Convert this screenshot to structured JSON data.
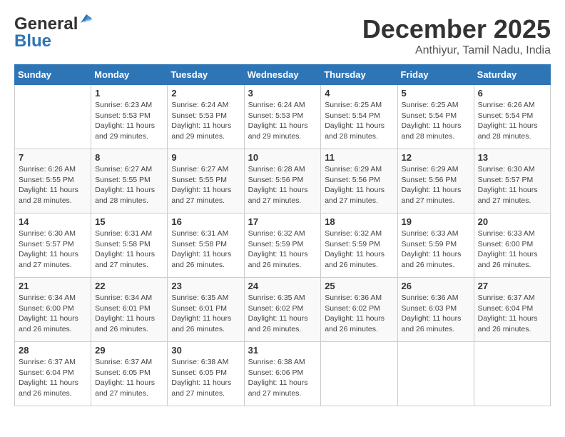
{
  "header": {
    "logo_general": "General",
    "logo_blue": "Blue",
    "month_title": "December 2025",
    "subtitle": "Anthiyur, Tamil Nadu, India"
  },
  "days_of_week": [
    "Sunday",
    "Monday",
    "Tuesday",
    "Wednesday",
    "Thursday",
    "Friday",
    "Saturday"
  ],
  "weeks": [
    [
      {
        "day": "",
        "info": ""
      },
      {
        "day": "1",
        "info": "Sunrise: 6:23 AM\nSunset: 5:53 PM\nDaylight: 11 hours\nand 29 minutes."
      },
      {
        "day": "2",
        "info": "Sunrise: 6:24 AM\nSunset: 5:53 PM\nDaylight: 11 hours\nand 29 minutes."
      },
      {
        "day": "3",
        "info": "Sunrise: 6:24 AM\nSunset: 5:53 PM\nDaylight: 11 hours\nand 29 minutes."
      },
      {
        "day": "4",
        "info": "Sunrise: 6:25 AM\nSunset: 5:54 PM\nDaylight: 11 hours\nand 28 minutes."
      },
      {
        "day": "5",
        "info": "Sunrise: 6:25 AM\nSunset: 5:54 PM\nDaylight: 11 hours\nand 28 minutes."
      },
      {
        "day": "6",
        "info": "Sunrise: 6:26 AM\nSunset: 5:54 PM\nDaylight: 11 hours\nand 28 minutes."
      }
    ],
    [
      {
        "day": "7",
        "info": "Sunrise: 6:26 AM\nSunset: 5:55 PM\nDaylight: 11 hours\nand 28 minutes."
      },
      {
        "day": "8",
        "info": "Sunrise: 6:27 AM\nSunset: 5:55 PM\nDaylight: 11 hours\nand 28 minutes."
      },
      {
        "day": "9",
        "info": "Sunrise: 6:27 AM\nSunset: 5:55 PM\nDaylight: 11 hours\nand 27 minutes."
      },
      {
        "day": "10",
        "info": "Sunrise: 6:28 AM\nSunset: 5:56 PM\nDaylight: 11 hours\nand 27 minutes."
      },
      {
        "day": "11",
        "info": "Sunrise: 6:29 AM\nSunset: 5:56 PM\nDaylight: 11 hours\nand 27 minutes."
      },
      {
        "day": "12",
        "info": "Sunrise: 6:29 AM\nSunset: 5:56 PM\nDaylight: 11 hours\nand 27 minutes."
      },
      {
        "day": "13",
        "info": "Sunrise: 6:30 AM\nSunset: 5:57 PM\nDaylight: 11 hours\nand 27 minutes."
      }
    ],
    [
      {
        "day": "14",
        "info": "Sunrise: 6:30 AM\nSunset: 5:57 PM\nDaylight: 11 hours\nand 27 minutes."
      },
      {
        "day": "15",
        "info": "Sunrise: 6:31 AM\nSunset: 5:58 PM\nDaylight: 11 hours\nand 27 minutes."
      },
      {
        "day": "16",
        "info": "Sunrise: 6:31 AM\nSunset: 5:58 PM\nDaylight: 11 hours\nand 26 minutes."
      },
      {
        "day": "17",
        "info": "Sunrise: 6:32 AM\nSunset: 5:59 PM\nDaylight: 11 hours\nand 26 minutes."
      },
      {
        "day": "18",
        "info": "Sunrise: 6:32 AM\nSunset: 5:59 PM\nDaylight: 11 hours\nand 26 minutes."
      },
      {
        "day": "19",
        "info": "Sunrise: 6:33 AM\nSunset: 5:59 PM\nDaylight: 11 hours\nand 26 minutes."
      },
      {
        "day": "20",
        "info": "Sunrise: 6:33 AM\nSunset: 6:00 PM\nDaylight: 11 hours\nand 26 minutes."
      }
    ],
    [
      {
        "day": "21",
        "info": "Sunrise: 6:34 AM\nSunset: 6:00 PM\nDaylight: 11 hours\nand 26 minutes."
      },
      {
        "day": "22",
        "info": "Sunrise: 6:34 AM\nSunset: 6:01 PM\nDaylight: 11 hours\nand 26 minutes."
      },
      {
        "day": "23",
        "info": "Sunrise: 6:35 AM\nSunset: 6:01 PM\nDaylight: 11 hours\nand 26 minutes."
      },
      {
        "day": "24",
        "info": "Sunrise: 6:35 AM\nSunset: 6:02 PM\nDaylight: 11 hours\nand 26 minutes."
      },
      {
        "day": "25",
        "info": "Sunrise: 6:36 AM\nSunset: 6:02 PM\nDaylight: 11 hours\nand 26 minutes."
      },
      {
        "day": "26",
        "info": "Sunrise: 6:36 AM\nSunset: 6:03 PM\nDaylight: 11 hours\nand 26 minutes."
      },
      {
        "day": "27",
        "info": "Sunrise: 6:37 AM\nSunset: 6:04 PM\nDaylight: 11 hours\nand 26 minutes."
      }
    ],
    [
      {
        "day": "28",
        "info": "Sunrise: 6:37 AM\nSunset: 6:04 PM\nDaylight: 11 hours\nand 26 minutes."
      },
      {
        "day": "29",
        "info": "Sunrise: 6:37 AM\nSunset: 6:05 PM\nDaylight: 11 hours\nand 27 minutes."
      },
      {
        "day": "30",
        "info": "Sunrise: 6:38 AM\nSunset: 6:05 PM\nDaylight: 11 hours\nand 27 minutes."
      },
      {
        "day": "31",
        "info": "Sunrise: 6:38 AM\nSunset: 6:06 PM\nDaylight: 11 hours\nand 27 minutes."
      },
      {
        "day": "",
        "info": ""
      },
      {
        "day": "",
        "info": ""
      },
      {
        "day": "",
        "info": ""
      }
    ]
  ]
}
